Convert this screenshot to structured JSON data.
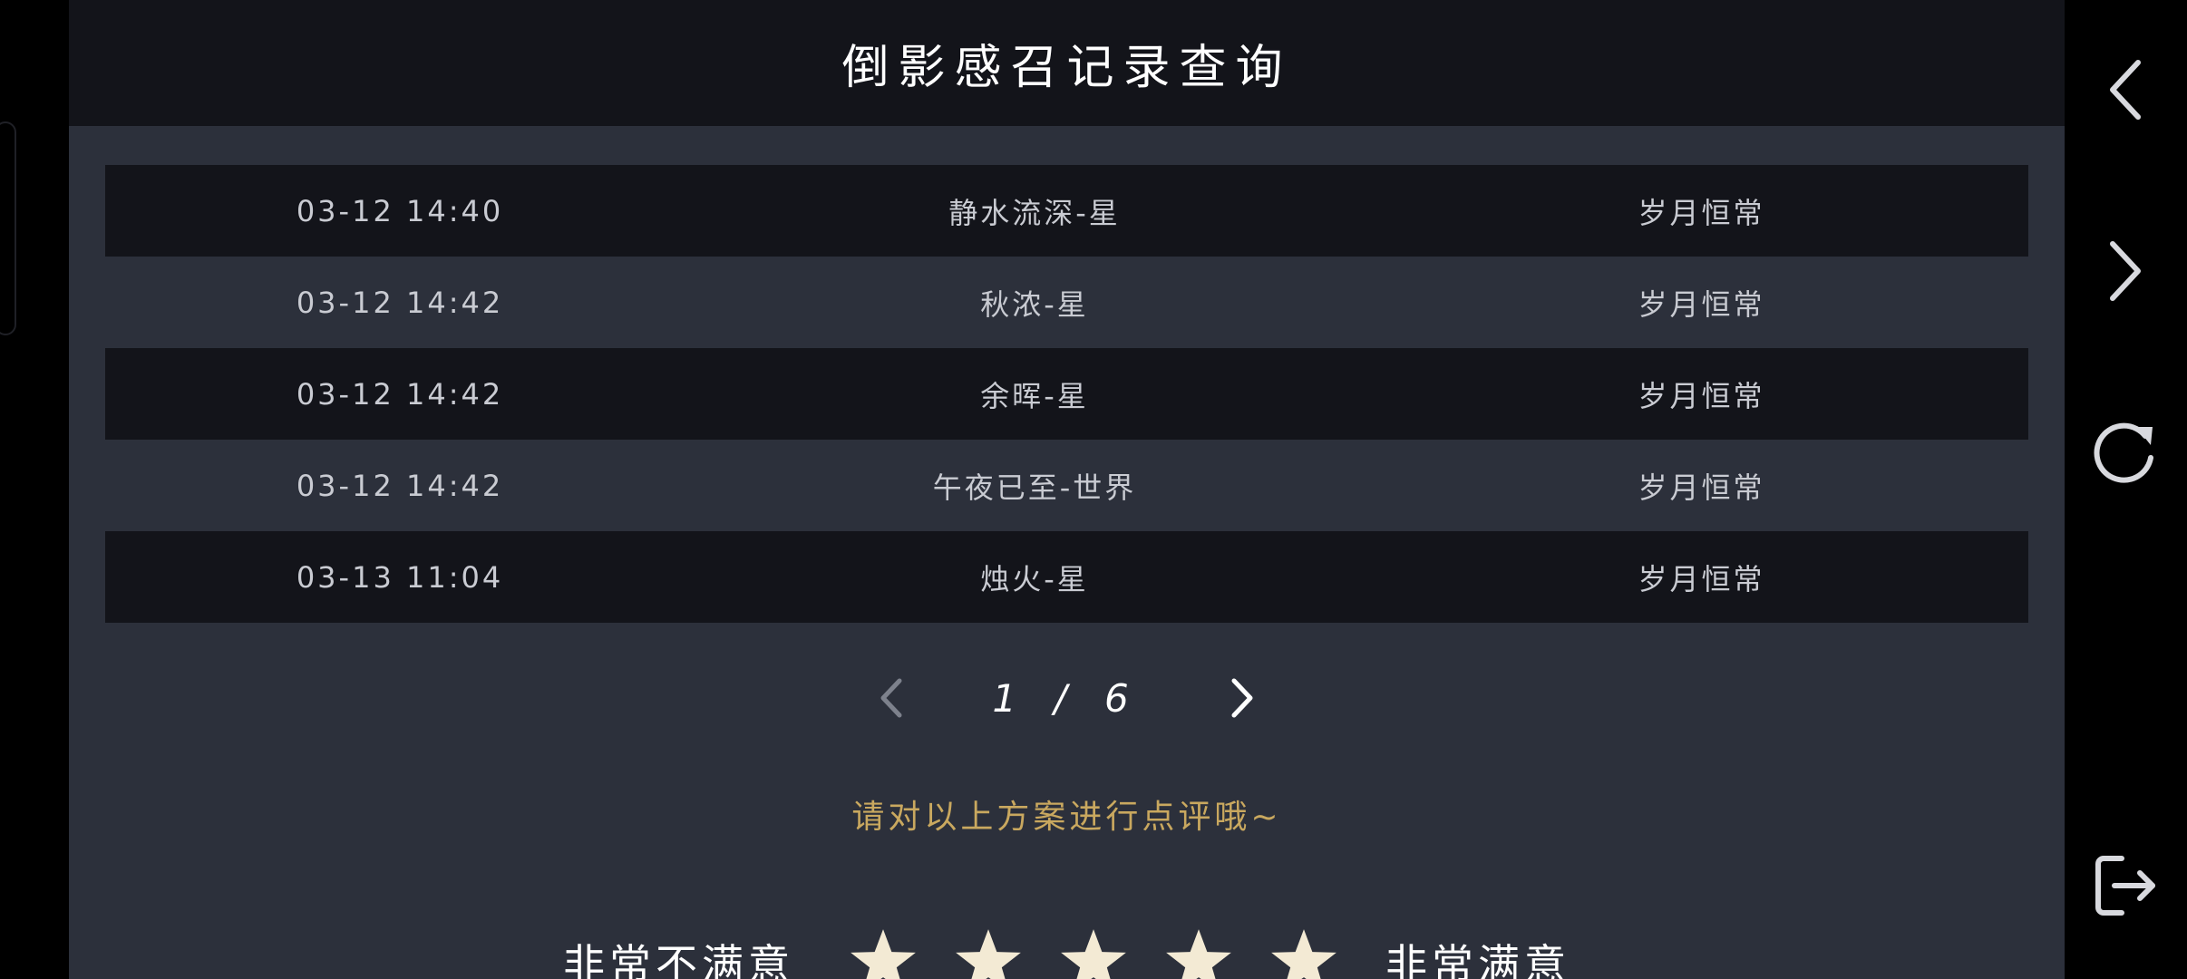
{
  "header": {
    "title": "倒影感召记录查询"
  },
  "table": {
    "rows": [
      {
        "time": "03-12 14:40",
        "name": "静水流深-星",
        "tag": "岁月恒常"
      },
      {
        "time": "03-12 14:42",
        "name": "秋浓-星",
        "tag": "岁月恒常"
      },
      {
        "time": "03-12 14:42",
        "name": "余晖-星",
        "tag": "岁月恒常"
      },
      {
        "time": "03-12 14:42",
        "name": "午夜已至-世界",
        "tag": "岁月恒常"
      },
      {
        "time": "03-13 11:04",
        "name": "烛火-星",
        "tag": "岁月恒常"
      }
    ]
  },
  "pagination": {
    "current": "1",
    "separator": "/",
    "total": "6"
  },
  "feedback": {
    "prompt": "请对以上方案进行点评哦~",
    "low_label": "非常不满意",
    "high_label": "非常满意",
    "star_count": 5
  },
  "colors": {
    "panel": "#2c303b",
    "header": "#13141a",
    "row_dark": "#13141a",
    "accent_gold": "#c9a85f",
    "star_fill": "#f3ead4"
  },
  "icons": {
    "rail": [
      "back-arrow-icon",
      "forward-arrow-icon",
      "refresh-icon",
      "exit-icon"
    ],
    "pager": [
      "chevron-left-icon",
      "chevron-right-icon"
    ],
    "rating": "star-icon"
  }
}
